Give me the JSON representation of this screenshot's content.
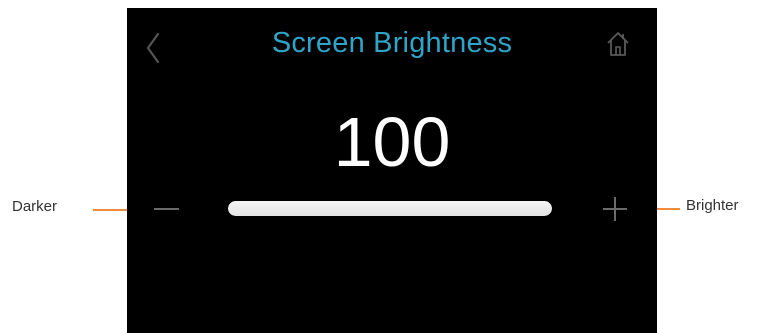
{
  "header": {
    "title": "Screen Brightness",
    "back_icon": "chevron-left-icon",
    "home_icon": "home-icon"
  },
  "brightness": {
    "value_label": "100",
    "level_fraction": 1.0,
    "decrease_icon": "minus-icon",
    "increase_icon": "plus-icon"
  },
  "callouts": {
    "decrease_label": "Darker",
    "increase_label": "Brighter"
  },
  "colors": {
    "screen_background": "#000000",
    "title": "#2fa4c8",
    "callout_line": "#f08a3c",
    "slider_fill": "#f0f0f0"
  }
}
